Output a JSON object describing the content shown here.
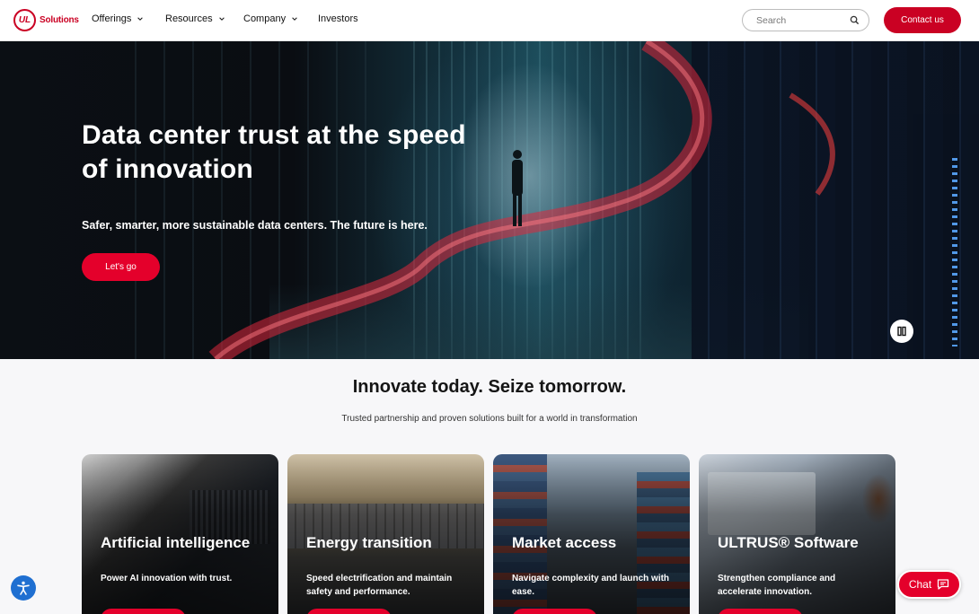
{
  "header": {
    "logo_mark": "UL",
    "logo_text": "Solutions",
    "nav": [
      {
        "label": "Offerings",
        "icon": "chevron-down-icon"
      },
      {
        "label": "Resources",
        "icon": "chevron-down-icon"
      },
      {
        "label": "Company",
        "icon": "chevron-down-icon"
      },
      {
        "label": "Investors"
      }
    ],
    "search_placeholder": "Search",
    "contact_label": "Contact us"
  },
  "hero": {
    "title": "Data center trust at the speed of innovation",
    "subtitle": "Safer, smarter, more sustainable data centers. The future is here.",
    "cta_label": "Let's go",
    "pause_icon": "pause-icon"
  },
  "section": {
    "title": "Innovate today. Seize tomorrow.",
    "subtitle": "Trusted partnership and proven solutions built for a world in transformation"
  },
  "cards": [
    {
      "title": "Artificial intelligence",
      "description": "Power AI innovation with trust."
    },
    {
      "title": "Energy transition",
      "description": "Speed electrification and maintain safety and performance."
    },
    {
      "title": "Market access",
      "description": "Navigate complexity and launch with ease."
    },
    {
      "title": "ULTRUS® Software",
      "description": "Strengthen compliance and accelerate innovation."
    }
  ],
  "floating": {
    "accessibility_icon": "accessibility-icon",
    "chat_label": "Chat",
    "chat_icon": "chat-bubble-icon"
  },
  "colors": {
    "brand_red": "#ca0123",
    "cta_red": "#e4002b",
    "accessibility_blue": "#1f6fd1"
  }
}
